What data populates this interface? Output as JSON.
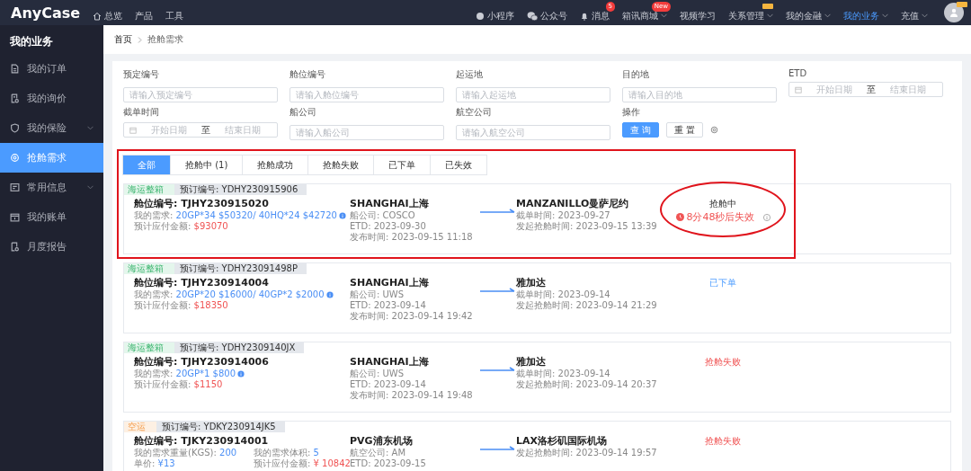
{
  "topbar": {
    "logo": "AnyCase",
    "left_items": [
      {
        "label": "总览"
      },
      {
        "label": "产品"
      },
      {
        "label": "工具"
      }
    ],
    "right_items": [
      {
        "label": "小程序",
        "caret": false,
        "selected": false,
        "vip": false
      },
      {
        "label": "公众号",
        "caret": false,
        "selected": false,
        "vip": false
      },
      {
        "label": "消息",
        "badge": "5",
        "caret": false,
        "selected": false,
        "vip": false
      },
      {
        "label": "箱讯商城",
        "badge": "New",
        "caret": true,
        "selected": false,
        "vip": false
      },
      {
        "label": "视频学习",
        "caret": false,
        "selected": false,
        "vip": false
      },
      {
        "label": "关系管理",
        "caret": true,
        "selected": false,
        "vip": true
      },
      {
        "label": "我的金融",
        "caret": true,
        "selected": false,
        "vip": false
      },
      {
        "label": "我的业务",
        "caret": true,
        "selected": true,
        "vip": false
      },
      {
        "label": "充值",
        "caret": true,
        "selected": false,
        "vip": false
      }
    ],
    "avatar_vip": true
  },
  "sidebar": {
    "title": "我的业务",
    "items": [
      {
        "label": "我的订单",
        "caret": false,
        "selected": false
      },
      {
        "label": "我的询价",
        "caret": false,
        "selected": false
      },
      {
        "label": "我的保险",
        "caret": true,
        "selected": false
      },
      {
        "label": "抢舱需求",
        "caret": false,
        "selected": true
      },
      {
        "label": "常用信息",
        "caret": true,
        "selected": false
      },
      {
        "label": "我的账单",
        "caret": false,
        "selected": false
      },
      {
        "label": "月度报告",
        "caret": false,
        "selected": false
      }
    ]
  },
  "breadcrumb": [
    {
      "label": "首页"
    },
    {
      "label": "抢舱需求"
    }
  ],
  "filters": [
    {
      "kind": "text",
      "label": "预定编号",
      "placeholder": "请输入预定编号"
    },
    {
      "kind": "text",
      "label": "舱位编号",
      "placeholder": "请输入舱位编号"
    },
    {
      "kind": "text",
      "label": "起运地",
      "placeholder": "请输入起运地"
    },
    {
      "kind": "text",
      "label": "目的地",
      "placeholder": "请输入目的地"
    },
    {
      "kind": "daterange",
      "label": "ETD",
      "start": "开始日期",
      "separator": "至",
      "end": "结束日期"
    },
    {
      "kind": "daterange",
      "label": "截单时间",
      "start": "开始日期",
      "separator": "至",
      "end": "结束日期"
    },
    {
      "kind": "text",
      "label": "船公司",
      "placeholder": "请输入船公司"
    },
    {
      "kind": "text",
      "label": "航空公司",
      "placeholder": "请输入航空公司"
    },
    {
      "kind": "actions",
      "label": "操作",
      "search": "查 询",
      "reset": "重 置"
    }
  ],
  "tabs": [
    {
      "label": "全部",
      "selected": true
    },
    {
      "label": "抢舱中 (1)",
      "selected": false
    },
    {
      "label": "抢舱成功",
      "selected": false
    },
    {
      "label": "抢舱失败",
      "selected": false
    },
    {
      "label": "已下单",
      "selected": false
    },
    {
      "label": "已失效",
      "selected": false
    }
  ],
  "cards": [
    {
      "tag": {
        "text": "海运整箱",
        "kind": "sea"
      },
      "booking_no": "预订编号: YDHY230915906",
      "slot_no": "舱位编号: TJHY230915020",
      "details": [
        [
          {
            "label": "我的需求: ",
            "value": "20GP*34 $50320/ 40HQ*24 $42720",
            "color": "#4b8ff5",
            "info": true
          }
        ],
        [
          {
            "label": "预计应付金额: ",
            "value": "$93070",
            "color": "#f05454",
            "info": false
          }
        ]
      ],
      "origin": {
        "name": "SHANGHAI上海",
        "lines": [
          "船公司: COSCO",
          "ETD: 2023-09-30",
          "发布时间: 2023-09-15 11:18"
        ]
      },
      "destination": {
        "name": "MANZANILLO曼萨尼约",
        "lines": [
          "截单时间: 2023-09-27",
          "发起抢舱时间: 2023-09-15 13:39"
        ]
      },
      "status": {
        "kind": "pending",
        "text": "抢舱中",
        "countdown": "8分48秒后失效"
      }
    },
    {
      "tag": {
        "text": "海运整箱",
        "kind": "sea"
      },
      "booking_no": "预订编号: YDHY23091498P",
      "slot_no": "舱位编号: TJHY230914004",
      "details": [
        [
          {
            "label": "我的需求: ",
            "value": "20GP*20 $16000/ 40GP*2 $2000",
            "color": "#4b8ff5",
            "info": true
          }
        ],
        [
          {
            "label": "预计应付金额: ",
            "value": "$18350",
            "color": "#f05454",
            "info": false
          }
        ]
      ],
      "origin": {
        "name": "SHANGHAI上海",
        "lines": [
          "船公司: UWS",
          "ETD: 2023-09-14",
          "发布时间: 2023-09-14 19:42"
        ]
      },
      "destination": {
        "name": "雅加达",
        "lines": [
          "截单时间: 2023-09-14",
          "发起抢舱时间: 2023-09-14 21:29"
        ]
      },
      "status": {
        "kind": "ordered",
        "text": "已下单"
      }
    },
    {
      "tag": {
        "text": "海运整箱",
        "kind": "sea"
      },
      "booking_no": "预订编号: YDHY2309140JX",
      "slot_no": "舱位编号: TJHY230914006",
      "details": [
        [
          {
            "label": "我的需求: ",
            "value": "20GP*1 $800",
            "color": "#4b8ff5",
            "info": true
          }
        ],
        [
          {
            "label": "预计应付金额: ",
            "value": "$1150",
            "color": "#f05454",
            "info": false
          }
        ]
      ],
      "origin": {
        "name": "SHANGHAI上海",
        "lines": [
          "船公司: UWS",
          "ETD: 2023-09-14",
          "发布时间: 2023-09-14 19:48"
        ]
      },
      "destination": {
        "name": "雅加达",
        "lines": [
          "截单时间: 2023-09-14",
          "发起抢舱时间: 2023-09-14 20:37"
        ]
      },
      "status": {
        "kind": "failed",
        "text": "抢舱失败"
      }
    },
    {
      "tag": {
        "text": "空运",
        "kind": "air"
      },
      "booking_no": "预订编号: YDKY230914JK5",
      "slot_no": "舱位编号: TJKY230914001",
      "details": [
        [
          {
            "label": "我的需求重量(KGS): ",
            "value": "200",
            "color": "#4b8ff5",
            "info": false
          },
          {
            "label": "我的需求体积: ",
            "value": "5",
            "color": "#4b8ff5",
            "info": false
          }
        ],
        [
          {
            "label": "单价: ",
            "value": "¥13",
            "color": "#4b8ff5",
            "info": false
          },
          {
            "label": "预计应付金额: ",
            "value": "¥ 10842",
            "color": "#f05454",
            "info": false
          }
        ]
      ],
      "origin": {
        "name": "PVG浦东机场",
        "lines": [
          "航空公司: AM",
          "ETD: 2023-09-15"
        ]
      },
      "destination": {
        "name": "LAX洛杉矶国际机场",
        "lines": [
          "发起抢舱时间: 2023-09-14 19:57"
        ]
      },
      "status": {
        "kind": "failed",
        "text": "抢舱失败"
      }
    }
  ],
  "annotations": [
    {
      "kind": "rectangle"
    },
    {
      "kind": "ellipse"
    }
  ]
}
